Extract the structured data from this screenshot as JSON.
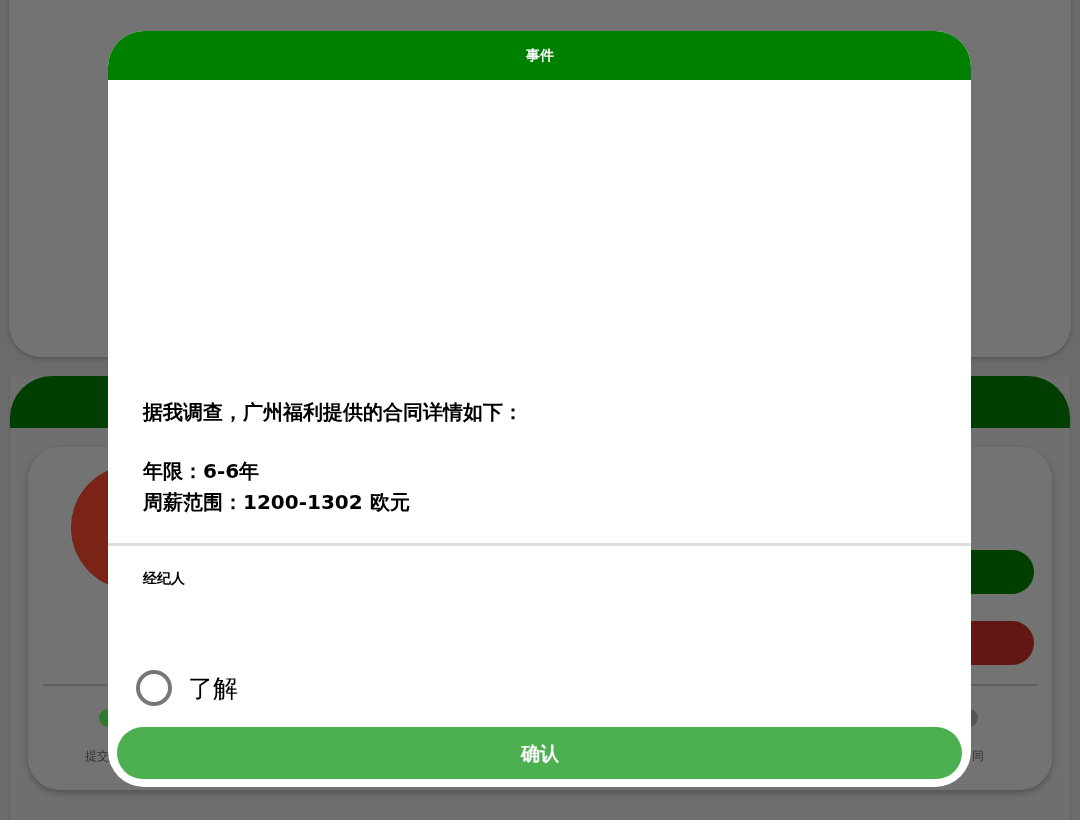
{
  "background": {
    "bottom_labels": [
      "提交",
      "同"
    ]
  },
  "modal": {
    "title": "事件",
    "intro": "据我调查，广州福利提供的合同详情如下：",
    "details": [
      "年限：6-6年",
      "周薪范围：1200-1302 欧元"
    ],
    "section_label": "经纪人",
    "options": [
      {
        "label": "了解",
        "selected": false
      }
    ],
    "confirm_button": "确认"
  }
}
